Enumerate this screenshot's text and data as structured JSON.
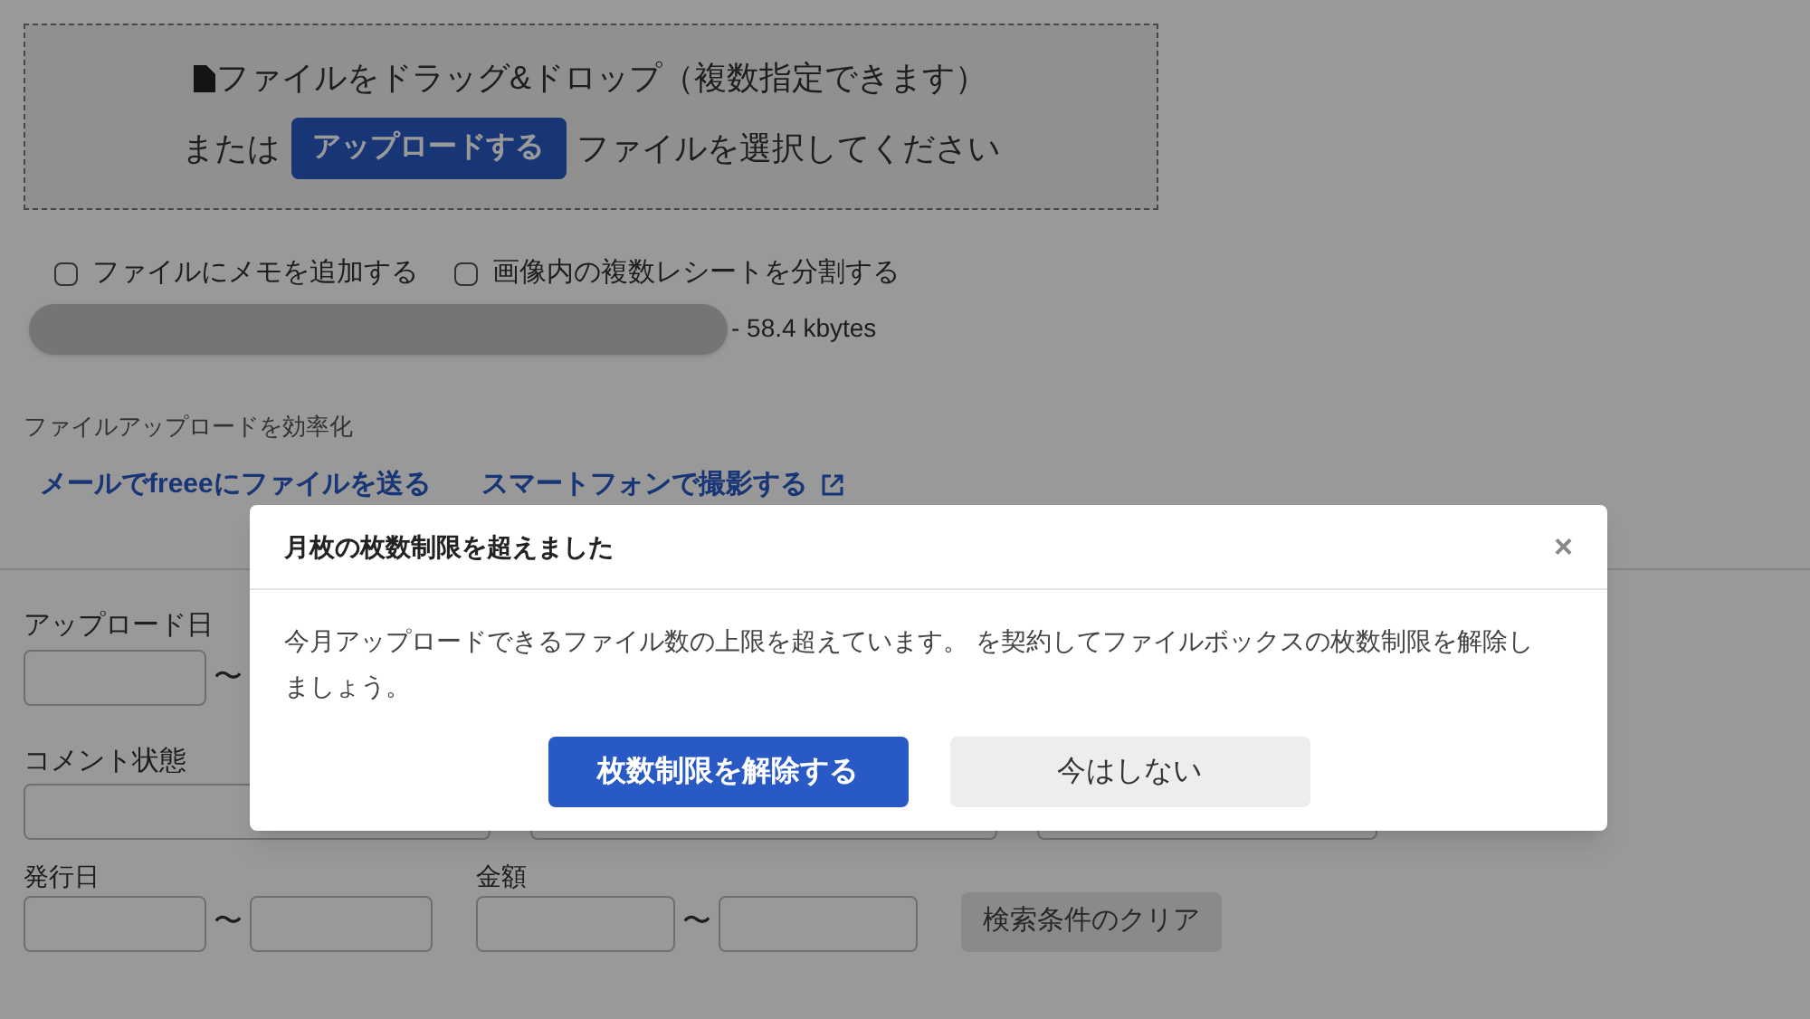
{
  "dropzone": {
    "line1": "ファイルをドラッグ&ドロップ（複数指定できます）",
    "prefix": "または",
    "upload_button": "アップロードする",
    "suffix": "ファイルを選択してください"
  },
  "options": [
    {
      "label": "ファイルにメモを追加する",
      "checked": false
    },
    {
      "label": "画像内の複数レシートを分割する",
      "checked": false
    }
  ],
  "upload": {
    "size": "- 58.4 kbytes"
  },
  "efficiency": {
    "heading": "ファイルアップロードを効率化",
    "links": [
      {
        "label": "メールでfreeeにファイルを送る",
        "external": false
      },
      {
        "label": "スマートフォンで撮影する",
        "external": true
      }
    ]
  },
  "filters": {
    "upload_date": {
      "label": "アップロード日",
      "separator": "〜"
    },
    "comment_state": {
      "label": "コメント状態"
    },
    "issue_date": {
      "label": "発行日",
      "separator": "〜"
    },
    "amount": {
      "label": "金額",
      "separator": "〜"
    },
    "clear_button": "検索条件のクリア"
  },
  "modal": {
    "title": "月枚の枚数制限を超えました",
    "close": "×",
    "body": "今月アップロードできるファイル数の上限を超えています。 を契約してファイルボックスの枚数制限を解除しましょう。",
    "buttons": [
      {
        "label": "枚数制限を解除する",
        "kind": "primary"
      },
      {
        "label": "今はしない",
        "kind": "secondary"
      }
    ]
  }
}
